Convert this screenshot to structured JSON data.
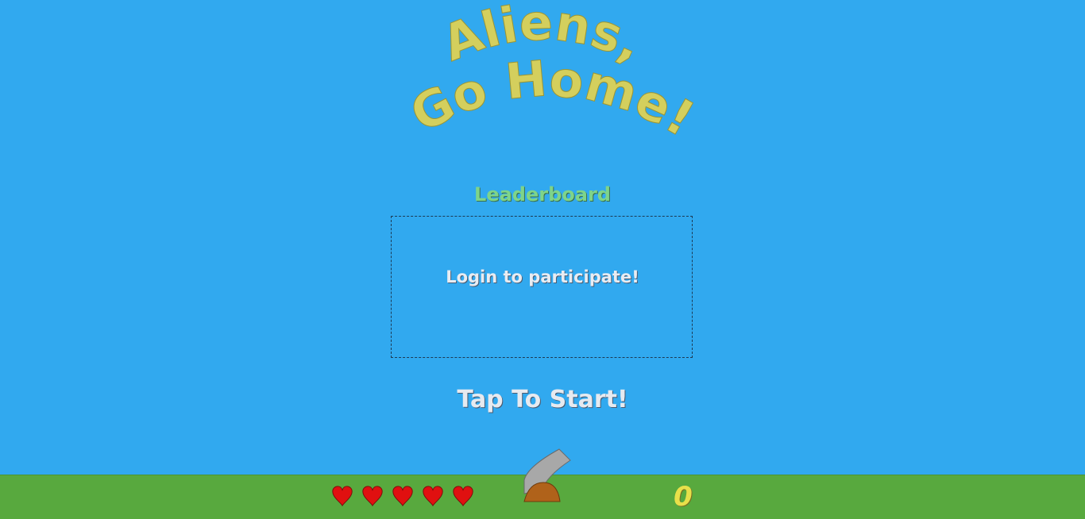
{
  "game": {
    "title_line1": "Aliens,",
    "title_line2": "Go Home!",
    "leaderboard_heading": "Leaderboard",
    "leaderboard_message": "Login to participate!",
    "start_prompt": "Tap To Start!",
    "lives": 5,
    "score": "0"
  },
  "colors": {
    "sky": "#31a9ef",
    "ground": "#58a93e",
    "title": "#d4cf5d",
    "heart": "#e01010",
    "score": "#e8e04a"
  },
  "icons": {
    "life": "heart-icon",
    "player": "cannon-icon"
  }
}
